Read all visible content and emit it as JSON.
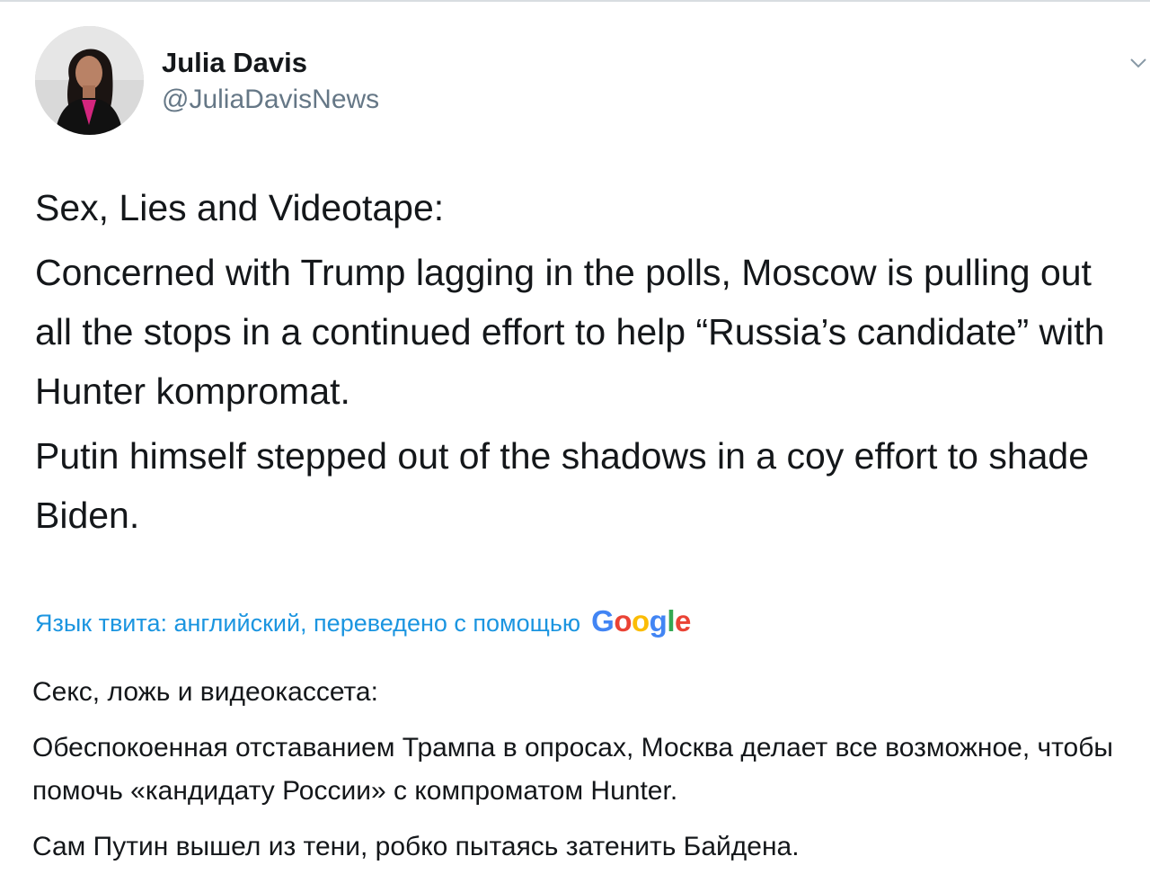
{
  "author": {
    "display_name": "Julia Davis",
    "handle": "@JuliaDavisNews"
  },
  "icons": {
    "menu": "chevron-down-icon",
    "avatar": "avatar-photo"
  },
  "tweet": {
    "paragraphs": [
      "Sex, Lies and Videotape:",
      "Concerned with Trump lagging in the polls, Moscow is pulling out all the stops in a continued effort to help “Russia’s candidate” with Hunter kompromat.",
      "Putin himself stepped out of the shadows in a coy effort to shade Biden."
    ]
  },
  "translation": {
    "label": "Язык твита: английский, переведено с помощью",
    "provider": "Google",
    "provider_colors": [
      "#4285f4",
      "#ea4335",
      "#fbbc05",
      "#4285f4",
      "#34a853",
      "#ea4335"
    ],
    "paragraphs": [
      "Секс, ложь и видеокассета:",
      " Обеспокоенная отставанием Трампа в опросах, Москва делает все возможное, чтобы помочь «кандидату России» с компроматом Hunter.",
      " Сам Путин вышел из тени, робко пытаясь затенить Байдена."
    ]
  },
  "colors": {
    "link_blue": "#1b95e0",
    "text": "#14171a",
    "secondary_text": "#657786"
  }
}
